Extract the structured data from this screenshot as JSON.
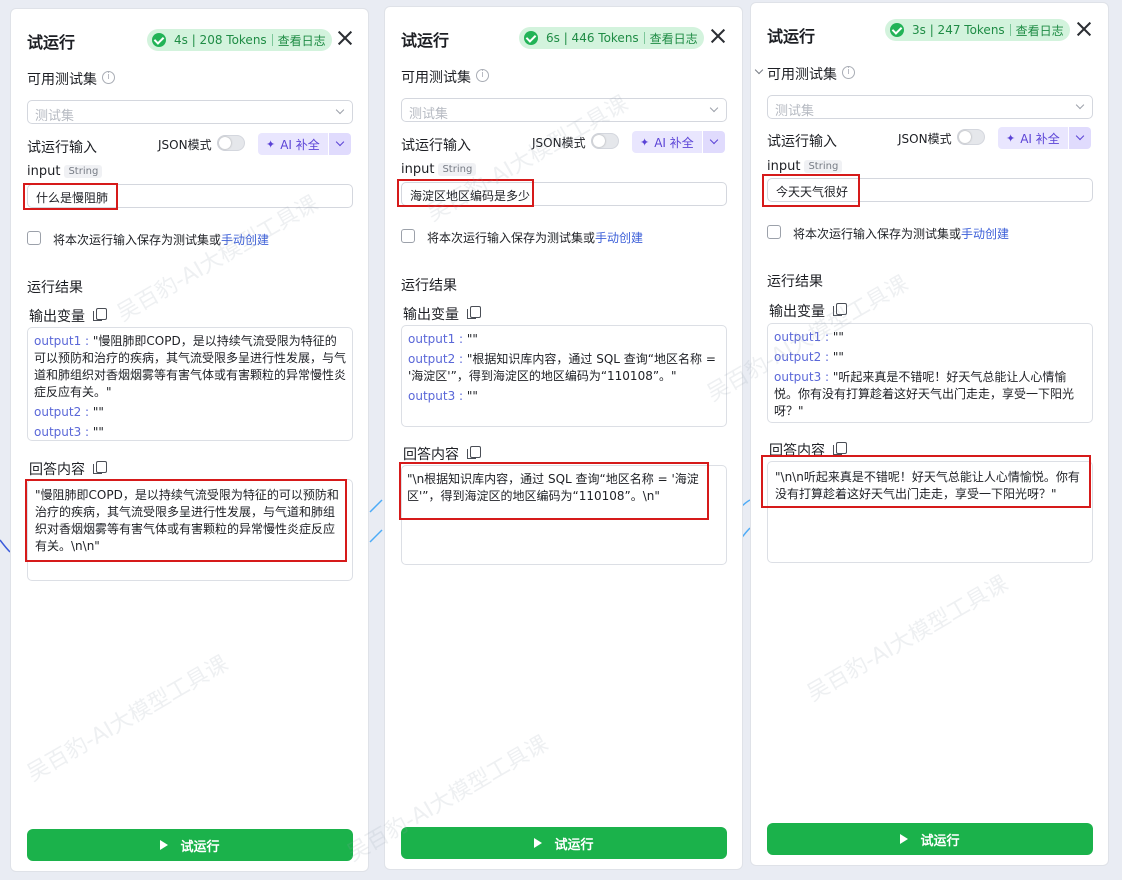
{
  "panels": [
    {
      "title": "试运行",
      "status": {
        "metrics": "4s | 208 Tokens",
        "log_link": "查看日志",
        "color": "#22b357"
      },
      "test_set_label": "可用测试集",
      "test_set_placeholder": "测试集",
      "input_section_label": "试运行输入",
      "json_mode_label": "JSON模式",
      "ai_button_label": "AI 补全",
      "input_var_name": "input",
      "input_var_type": "String",
      "input_value": "什么是慢阻肺",
      "save_prefix": "将本次运行输入保存为测试集或",
      "save_link": "手动创建",
      "results_label": "运行结果",
      "output_vars_label": "输出变量",
      "outputs": [
        {
          "key": "output1",
          "value": "\"慢阻肺即COPD，是以持续气流受限为特征的可以预防和治疗的疾病，其气流受限多呈进行性发展，与气道和肺组织对香烟烟雾等有害气体或有害颗粒的异常慢性炎症反应有关。\""
        },
        {
          "key": "output2",
          "value": "\"\""
        },
        {
          "key": "output3",
          "value": "\"\""
        }
      ],
      "answer_label": "回答内容",
      "answer_text": "\"慢阻肺即COPD，是以持续气流受限为特征的可以预防和治疗的疾病，其气流受限多呈进行性发展，与气道和肺组织对香烟烟雾等有害气体或有害颗粒的异常慢性炎症反应有关。\\n\\n\"",
      "run_button_label": "试运行"
    },
    {
      "title": "试运行",
      "status": {
        "metrics": "6s | 446 Tokens",
        "log_link": "查看日志",
        "color": "#22b357"
      },
      "test_set_label": "可用测试集",
      "test_set_placeholder": "测试集",
      "input_section_label": "试运行输入",
      "json_mode_label": "JSON模式",
      "ai_button_label": "AI 补全",
      "input_var_name": "input",
      "input_var_type": "String",
      "input_value": "海淀区地区编码是多少",
      "save_prefix": "将本次运行输入保存为测试集或",
      "save_link": "手动创建",
      "results_label": "运行结果",
      "output_vars_label": "输出变量",
      "outputs": [
        {
          "key": "output1",
          "value": "\"\""
        },
        {
          "key": "output2",
          "value": "\"根据知识库内容，通过 SQL 查询“地区名称 = '海淀区'”，得到海淀区的地区编码为“110108”。\""
        },
        {
          "key": "output3",
          "value": "\"\""
        }
      ],
      "answer_label": "回答内容",
      "answer_text": "\"\\n根据知识库内容，通过 SQL 查询“地区名称 = '海淀区'”，得到海淀区的地区编码为“110108”。\\n\"",
      "run_button_label": "试运行"
    },
    {
      "title": "试运行",
      "status": {
        "metrics": "3s | 247 Tokens",
        "log_link": "查看日志",
        "color": "#22b357"
      },
      "test_set_label": "可用测试集",
      "test_set_placeholder": "测试集",
      "input_section_label": "试运行输入",
      "json_mode_label": "JSON模式",
      "ai_button_label": "AI 补全",
      "input_var_name": "input",
      "input_var_type": "String",
      "input_value": "今天天气很好",
      "save_prefix": "将本次运行输入保存为测试集或",
      "save_link": "手动创建",
      "results_label": "运行结果",
      "output_vars_label": "输出变量",
      "outputs": [
        {
          "key": "output1",
          "value": "\"\""
        },
        {
          "key": "output2",
          "value": "\"\""
        },
        {
          "key": "output3",
          "value": "\"听起来真是不错呢！好天气总能让人心情愉悦。你有没有打算趁着这好天气出门走走，享受一下阳光呀？\""
        }
      ],
      "answer_label": "回答内容",
      "answer_text": "\"\\n\\n听起来真是不错呢！好天气总能让人心情愉悦。你有没有打算趁着这好天气出门走走，享受一下阳光呀？\"",
      "run_button_label": "试运行"
    }
  ],
  "watermark": "吴百豹-AI大模型工具课",
  "colors": {
    "accent_green": "#1bb24b",
    "highlight_red": "#d61a1a",
    "ai_purple": "#5b43d6",
    "link_blue": "#3c5fd8"
  }
}
